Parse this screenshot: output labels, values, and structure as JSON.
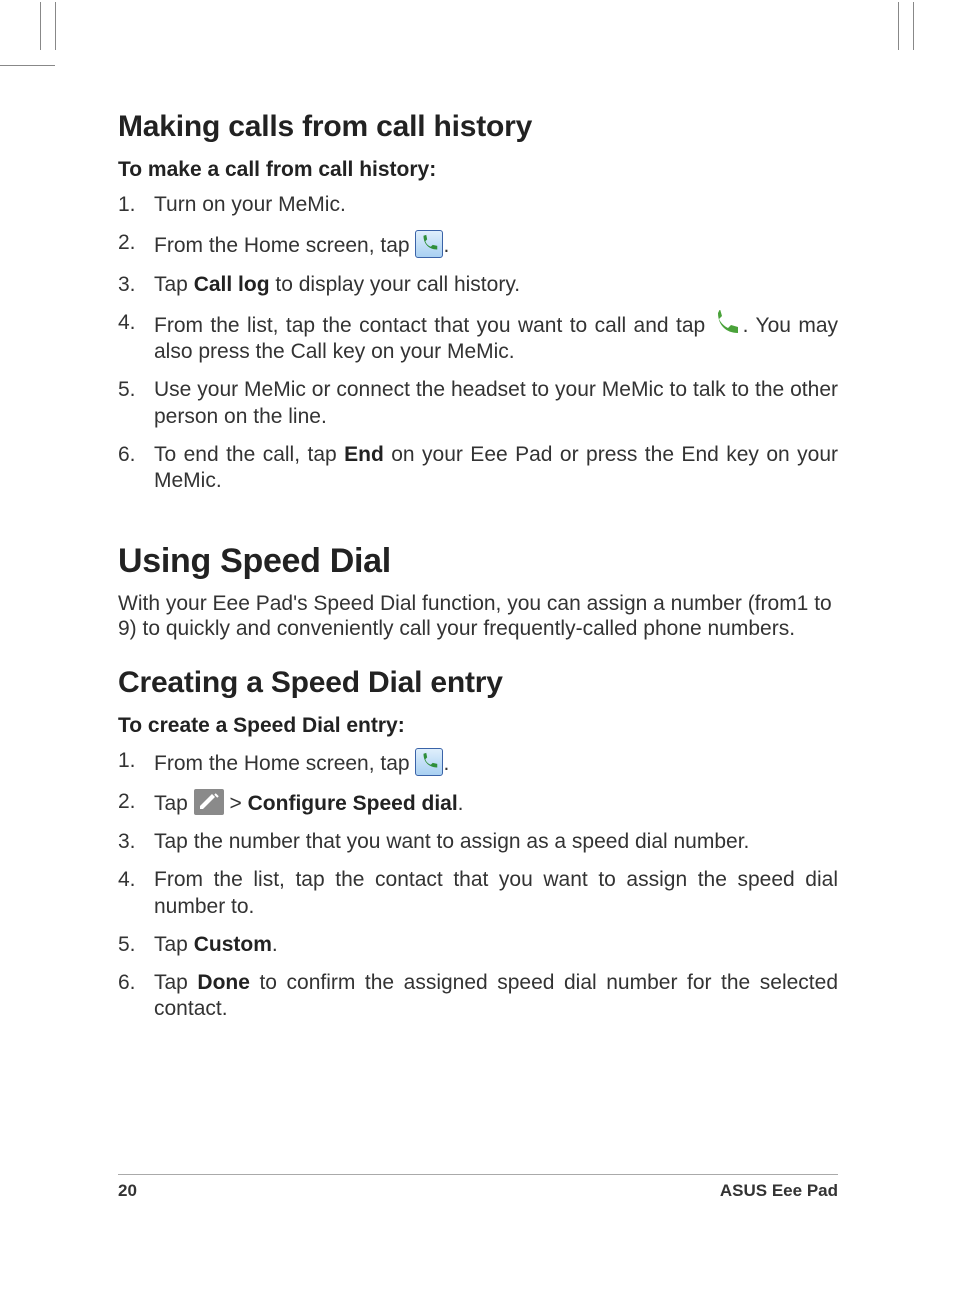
{
  "page_number": "20",
  "brand": "ASUS Eee Pad",
  "section1": {
    "title": "Making calls from call history",
    "subhead": "To make a call from call history:",
    "steps": [
      {
        "n": "1.",
        "pre": "Turn on your MeMic.",
        "bold": "",
        "post": ""
      },
      {
        "n": "2.",
        "pre": "From the Home screen, tap ",
        "icon": "phone-blue",
        "post": "."
      },
      {
        "n": "3.",
        "pre": "Tap ",
        "bold": "Call log",
        "post": " to display your call history."
      },
      {
        "n": "4.",
        "pre": "From the list, tap the contact that you want to call and tap ",
        "icon": "phone-green",
        "post": ".  You may also press the Call key on your MeMic."
      },
      {
        "n": "5.",
        "pre": "Use your MeMic or connect the headset to your MeMic to talk to the other person on the line.",
        "bold": "",
        "post": ""
      },
      {
        "n": "6.",
        "pre": "To end the call, tap ",
        "bold": "End",
        "post": " on your Eee Pad or press the End key on your MeMic."
      }
    ]
  },
  "chapter": {
    "title": "Using Speed Dial",
    "lead": "With your Eee Pad's Speed Dial function, you can assign a number (from1 to 9) to quickly and conveniently call your frequently-called phone numbers."
  },
  "section2": {
    "title": "Creating a Speed Dial entry",
    "subhead": "To create a Speed Dial entry:",
    "steps": [
      {
        "n": "1.",
        "pre": "From the Home screen, tap ",
        "icon": "phone-blue",
        "post": "."
      },
      {
        "n": "2.",
        "pre": "Tap ",
        "icon": "pencil",
        "mid": " > ",
        "bold": "Configure Speed dial",
        "post": "."
      },
      {
        "n": "3.",
        "pre": "Tap the number that you want to assign as a speed dial number.",
        "bold": "",
        "post": ""
      },
      {
        "n": "4.",
        "pre": "From the list, tap the contact that you want to assign the speed dial number to.",
        "bold": "",
        "post": ""
      },
      {
        "n": "5.",
        "pre": "Tap ",
        "bold": "Custom",
        "post": "."
      },
      {
        "n": "6.",
        "pre": "Tap ",
        "bold": "Done",
        "post": " to confirm the assigned speed dial number for the selected contact."
      }
    ]
  }
}
